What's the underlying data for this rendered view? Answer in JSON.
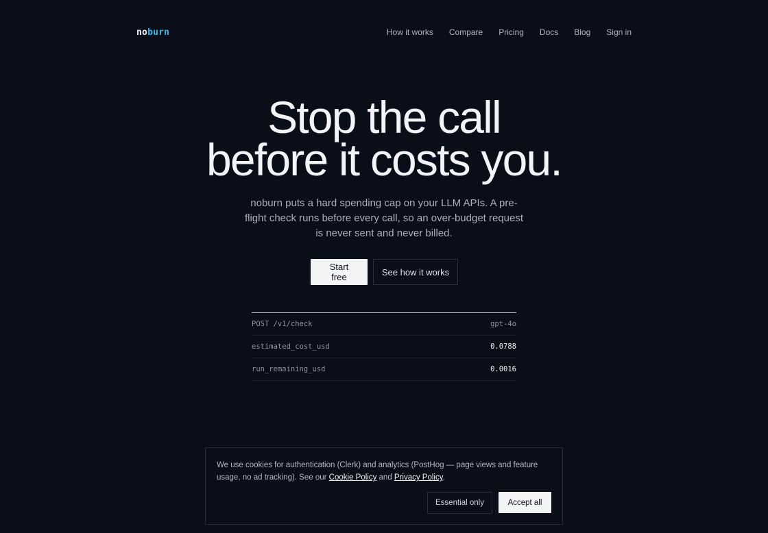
{
  "nav": {
    "logo_prefix": "no",
    "logo_suffix": "burn",
    "links": [
      "How it works",
      "Compare",
      "Pricing",
      "Docs",
      "Blog",
      "Sign in"
    ]
  },
  "hero": {
    "title_line1": "Stop the call",
    "title_line2": "before it costs you.",
    "subtitle": "noburn puts a hard spending cap on your LLM APIs. A pre-flight check runs before every call, so an over-budget request is never sent and never billed.",
    "primary_cta": "Start free",
    "secondary_cta": "See how it works"
  },
  "check": {
    "endpoint": "POST /v1/check",
    "model": "gpt-4o",
    "rows": [
      {
        "key": "estimated_cost_usd",
        "value": "0.0788"
      },
      {
        "key": "run_remaining_usd",
        "value": "0.0016"
      }
    ]
  },
  "cookie": {
    "text_before": "We use cookies for authentication (Clerk) and analytics (PostHog — page views and feature usage, no ad tracking). See our ",
    "cookie_policy": "Cookie Policy",
    "and": " and ",
    "privacy_policy": "Privacy Policy",
    "text_after": ".",
    "essential_label": "Essential only",
    "accept_label": "Accept all"
  },
  "colors": {
    "background": "#0a0e18",
    "accent": "#3fb4e8",
    "primary_button": "#f2f4f6"
  }
}
